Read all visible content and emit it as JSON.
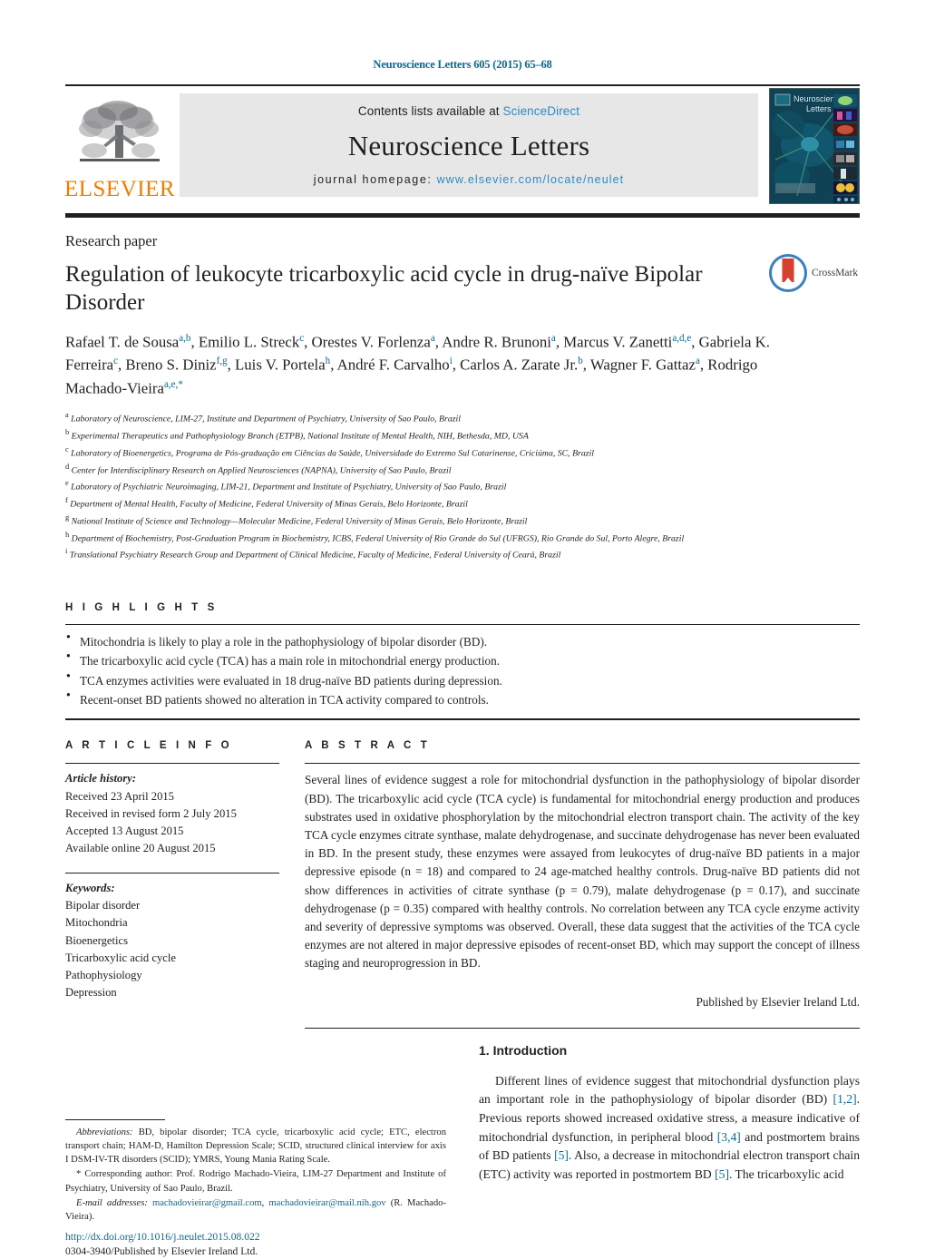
{
  "running_head": "Neuroscience Letters 605 (2015) 65–68",
  "masthead": {
    "publisher_word": "ELSEVIER",
    "contents_prefix": "Contents lists available at ",
    "contents_link": "ScienceDirect",
    "journal_title": "Neuroscience Letters",
    "homepage_prefix": "journal homepage: ",
    "homepage_url": "www.elsevier.com/locate/neulet",
    "cover_label": "Neuroscience Letters"
  },
  "article": {
    "doctype": "Research paper",
    "title": "Regulation of leukocyte tricarboxylic acid cycle in drug-naïve Bipolar Disorder",
    "crossmark_label": "CrossMark",
    "authors_html": "Rafael T. de Sousa<sup>a,b</sup>, Emilio L. Streck<sup>c</sup>, Orestes V. Forlenza<sup>a</sup>, Andre R. Brunoni<sup>a</sup>, Marcus V. Zanetti<sup>a,d,e</sup>, Gabriela K. Ferreira<sup>c</sup>, Breno S. Diniz<sup>f,g</sup>, Luis V. Portela<sup>h</sup>, André F. Carvalho<sup>i</sup>, Carlos A. Zarate Jr.<sup>b</sup>, Wagner F. Gattaz<sup>a</sup>, Rodrigo Machado-Vieira<sup>a,e,</sup><sup>*</sup>",
    "affiliations": [
      {
        "mark": "a",
        "text": "Laboratory of Neuroscience, LIM-27, Institute and Department of Psychiatry, University of Sao Paulo, Brazil"
      },
      {
        "mark": "b",
        "text": "Experimental Therapeutics and Pathophysiology Branch (ETPB), National Institute of Mental Health, NIH, Bethesda, MD, USA"
      },
      {
        "mark": "c",
        "text": "Laboratory of Bioenergetics, Programa de Pós-graduação em Ciências da Saúde, Universidade do Extremo Sul Catarinense, Criciúma, SC, Brazil"
      },
      {
        "mark": "d",
        "text": "Center for Interdisciplinary Research on Applied Neurosciences (NAPNA), University of Sao Paulo, Brazil"
      },
      {
        "mark": "e",
        "text": "Laboratory of Psychiatric Neuroimaging, LIM-21, Department and Institute of Psychiatry, University of Sao Paulo, Brazil"
      },
      {
        "mark": "f",
        "text": "Department of Mental Health, Faculty of Medicine, Federal University of Minas Gerais, Belo Horizonte, Brazil"
      },
      {
        "mark": "g",
        "text": "National Institute of Science and Technology—Molecular Medicine, Federal University of Minas Gerais, Belo Horizonte, Brazil"
      },
      {
        "mark": "h",
        "text": "Department of Biochemistry, Post-Graduation Program in Biochemistry, ICBS, Federal University of Rio Grande do Sul (UFRGS), Rio Grande do Sul, Porto Alegre, Brazil"
      },
      {
        "mark": "i",
        "text": "Translational Psychiatry Research Group and Department of Clinical Medicine, Faculty of Medicine, Federal University of Ceará, Brazil"
      }
    ]
  },
  "highlights": {
    "heading": "H I G H L I G H T S",
    "items": [
      "Mitochondria is likely to play a role in the pathophysiology of bipolar disorder (BD).",
      "The tricarboxylic acid cycle (TCA) has a main role in mitochondrial energy production.",
      "TCA enzymes activities were evaluated in 18 drug-naïve BD patients during depression.",
      "Recent-onset BD patients showed no alteration in TCA activity compared to controls."
    ]
  },
  "article_info": {
    "heading": "A R T I C L E    I N F O",
    "history_label": "Article history:",
    "history": [
      "Received 23 April 2015",
      "Received in revised form 2 July 2015",
      "Accepted 13 August 2015",
      "Available online 20 August 2015"
    ],
    "keywords_label": "Keywords:",
    "keywords": [
      "Bipolar disorder",
      "Mitochondria",
      "Bioenergetics",
      "Tricarboxylic acid cycle",
      "Pathophysiology",
      "Depression"
    ]
  },
  "abstract": {
    "heading": "A B S T R A C T",
    "text": "Several lines of evidence suggest a role for mitochondrial dysfunction in the pathophysiology of bipolar disorder (BD). The tricarboxylic acid cycle (TCA cycle) is fundamental for mitochondrial energy production and produces substrates used in oxidative phosphorylation by the mitochondrial electron transport chain. The activity of the key TCA cycle enzymes citrate synthase, malate dehydrogenase, and succinate dehydrogenase has never been evaluated in BD. In the present study, these enzymes were assayed from leukocytes of drug-naïve BD patients in a major depressive episode (n = 18) and compared to 24 age-matched healthy controls. Drug-naïve BD patients did not show differences in activities of citrate synthase (p = 0.79), malate dehydrogenase (p = 0.17), and succinate dehydrogenase (p = 0.35) compared with healthy controls. No correlation between any TCA cycle enzyme activity and severity of depressive symptoms was observed. Overall, these data suggest that the activities of the TCA cycle enzymes are not altered in major depressive episodes of recent-onset BD, which may support the concept of illness staging and neuroprogression in BD.",
    "publisher_line": "Published by Elsevier Ireland Ltd."
  },
  "footnotes": {
    "abbrev_label": "Abbreviations:",
    "abbrev_text": " BD, bipolar disorder; TCA cycle, tricarboxylic acid cycle; ETC, electron transport chain; HAM-D, Hamilton Depression Scale; SCID, structured clinical interview for axis I DSM-IV-TR disorders (SCID); YMRS, Young Mania Rating Scale.",
    "corresponding": "* Corresponding author: Prof. Rodrigo Machado-Vieira, LIM-27 Department and Institute of Psychiatry, University of Sao Paulo, Brazil.",
    "email_label": "E-mail addresses:",
    "email1": "machadovieirar@gmail.com",
    "email2": "machadovieirar@mail.nih.gov",
    "email_attrib": "(R. Machado-Vieira).",
    "doi": "http://dx.doi.org/10.1016/j.neulet.2015.08.022",
    "issn_line": "0304-3940/Published by Elsevier Ireland Ltd."
  },
  "introduction": {
    "heading": "1.  Introduction",
    "para_parts": [
      "Different lines of evidence suggest that mitochondrial dysfunction plays an important role in the pathophysiology of bipolar disorder (BD) ",
      "[1,2]",
      ". Previous reports showed increased oxidative stress, a measure indicative of mitochondrial dysfunction, in peripheral blood ",
      "[3,4]",
      " and postmortem brains of BD patients ",
      "[5]",
      ". Also, a decrease in mitochondrial electron transport chain (ETC) activity was reported in postmortem BD ",
      "[5]",
      ". The tricarboxylic acid"
    ]
  },
  "colors": {
    "link_teal": "#0b6a93",
    "sciencedirect_blue": "#2b8bc4",
    "elsevier_orange": "#f07d00",
    "band_gray": "#e7e7e8",
    "ink": "#231f20"
  }
}
